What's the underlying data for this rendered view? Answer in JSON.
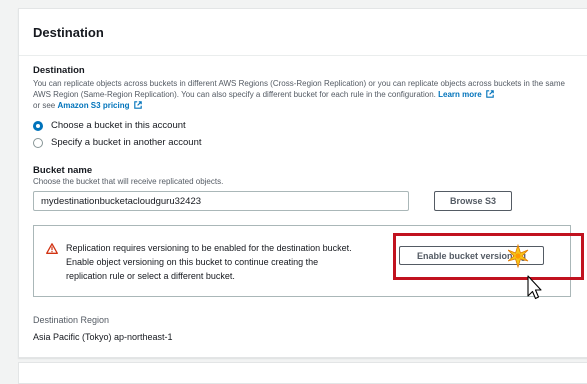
{
  "panel": {
    "title": "Destination"
  },
  "destination": {
    "label": "Destination",
    "description": "You can replicate objects across buckets in different AWS Regions (Cross-Region Replication) or you can replicate objects across buckets in the same AWS Region (Same-Region Replication). You can also specify a different bucket for each rule in the configuration.",
    "learn_more": "Learn more",
    "see_prefix": "or see",
    "pricing_link": "Amazon S3 pricing",
    "options": [
      {
        "label": "Choose a bucket in this account",
        "checked": true
      },
      {
        "label": "Specify a bucket in another account",
        "checked": false
      }
    ]
  },
  "bucket": {
    "label": "Bucket name",
    "description": "Choose the bucket that will receive replicated objects.",
    "value": "mydestinationbucketacloudguru32423",
    "browse_label": "Browse S3"
  },
  "alert": {
    "lines": [
      "Replication requires versioning to be enabled for the destination bucket.",
      "Enable object versioning on this bucket to continue creating the",
      "replication rule or select a different bucket."
    ],
    "button_label": "Enable bucket versioning"
  },
  "region": {
    "label": "Destination Region",
    "value": "Asia Pacific (Tokyo) ap-northeast-1"
  },
  "colors": {
    "link": "#0073bb",
    "warning": "#d13212",
    "highlight": "#c1121f"
  }
}
